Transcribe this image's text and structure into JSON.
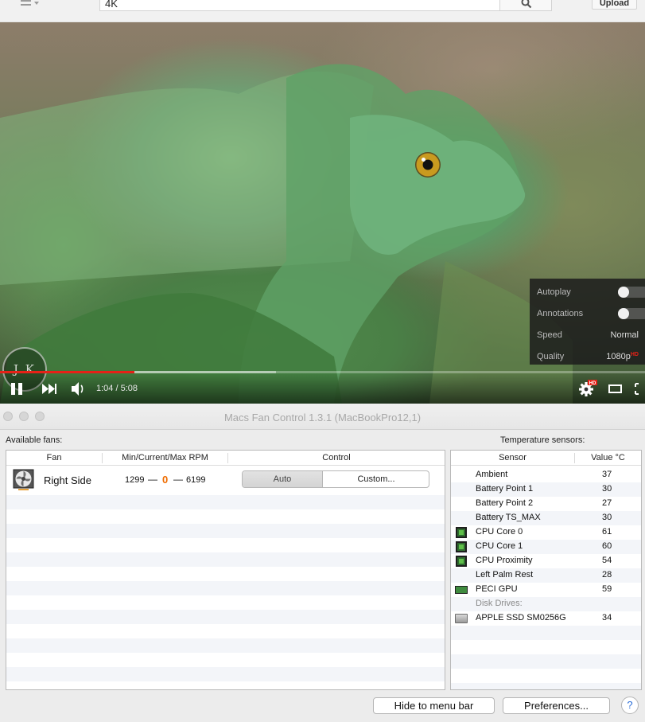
{
  "youtube": {
    "search_value": "4K",
    "upload_label": "Upload",
    "player": {
      "time": "1:04 / 5:08",
      "played_fraction": 0.2078,
      "buffered_fraction": 0.428,
      "watermark": "J K"
    },
    "settings": {
      "autoplay_label": "Autoplay",
      "annotations_label": "Annotations",
      "speed_label": "Speed",
      "speed_value": "Normal",
      "quality_label": "Quality",
      "quality_value": "1080p",
      "quality_badge": "HD"
    },
    "hd_badge": "HD"
  },
  "window": {
    "title": "Macs Fan Control 1.3.1 (MacBookPro12,1)"
  },
  "fans": {
    "section_label": "Available fans:",
    "headers": {
      "fan": "Fan",
      "rpm": "Min/Current/Max RPM",
      "control": "Control"
    },
    "rows": [
      {
        "name": "Right Side",
        "min": "1299",
        "sep": "—",
        "current": "0",
        "max": "6199",
        "auto_label": "Auto",
        "custom_label": "Custom..."
      }
    ]
  },
  "sensors": {
    "section_label": "Temperature sensors:",
    "headers": {
      "sensor": "Sensor",
      "value": "Value °C"
    },
    "rows": [
      {
        "name": "Ambient",
        "value": "37",
        "icon": ""
      },
      {
        "name": "Battery Point 1",
        "value": "30",
        "icon": ""
      },
      {
        "name": "Battery Point 2",
        "value": "27",
        "icon": ""
      },
      {
        "name": "Battery TS_MAX",
        "value": "30",
        "icon": ""
      },
      {
        "name": "CPU Core 0",
        "value": "61",
        "icon": "cpu-chip-icon"
      },
      {
        "name": "CPU Core 1",
        "value": "60",
        "icon": "cpu-chip-icon"
      },
      {
        "name": "CPU Proximity",
        "value": "54",
        "icon": "cpu-chip-icon"
      },
      {
        "name": "Left Palm Rest",
        "value": "28",
        "icon": ""
      },
      {
        "name": "PECI GPU",
        "value": "59",
        "icon": "gpu-card-icon"
      }
    ],
    "group_label": "Disk Drives:",
    "disk_rows": [
      {
        "name": "APPLE SSD SM0256G",
        "value": "34",
        "icon": "ssd-drive-icon"
      }
    ]
  },
  "buttons": {
    "hide_to_menu_bar": "Hide to menu bar",
    "preferences": "Preferences...",
    "help": "?"
  },
  "colors": {
    "progress_played": "#e62117",
    "current_rpm": "#ef6c00"
  }
}
